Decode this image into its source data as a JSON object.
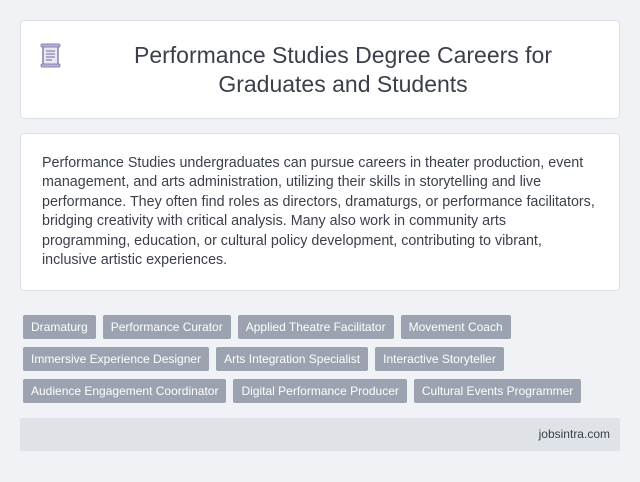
{
  "header": {
    "icon": "document-scroll-icon",
    "title": "Performance Studies Degree Careers for Graduates and Students"
  },
  "summary": {
    "text": "Performance Studies undergraduates can pursue careers in theater production, event management, and arts administration, utilizing their skills in storytelling and live performance. They often find roles as directors, dramaturgs, or performance facilitators, bridging creativity with critical analysis. Many also work in community arts programming, education, or cultural policy development, contributing to vibrant, inclusive artistic experiences."
  },
  "tags": [
    [
      "Dramaturg",
      "Performance Curator",
      "Applied Theatre Facilitator",
      "Movement Coach"
    ],
    [
      "Immersive Experience Designer",
      "Arts Integration Specialist",
      "Interactive Storyteller"
    ],
    [
      "Audience Engagement Coordinator",
      "Digital Performance Producer",
      "Cultural Events Programmer"
    ]
  ],
  "footer": {
    "site": "jobsintra.com"
  },
  "colors": {
    "background": "#f0f2f5",
    "tag_background": "#9aa3af",
    "footer_background": "#dfe2e7",
    "text": "#3a3f4a",
    "icon_accent": "#8a7fb0"
  }
}
